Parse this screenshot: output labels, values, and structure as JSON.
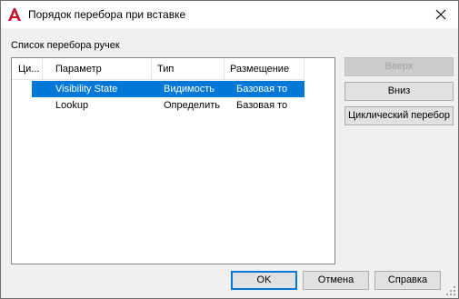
{
  "window": {
    "title": "Порядок перебора при вставке",
    "app_icon": "autocad-a-icon",
    "close_icon": "close-icon"
  },
  "list": {
    "caption": "Список перебора ручек",
    "columns": [
      "Ци...",
      "Параметр",
      "Тип",
      "Размещение"
    ],
    "rows": [
      {
        "parameter": "Visibility State",
        "type": "Видимость",
        "placement": "Базовая то",
        "selected": true
      },
      {
        "parameter": "Lookup",
        "type": "Определить",
        "placement": "Базовая то",
        "selected": false
      }
    ]
  },
  "side_buttons": {
    "up": "Вверх",
    "down": "Вниз",
    "cycle": "Циклический перебор"
  },
  "footer_buttons": {
    "ok": "OK",
    "cancel": "Отмена",
    "help": "Справка"
  },
  "colors": {
    "selection": "#0078d7",
    "app_icon_red": "#c8102e"
  }
}
